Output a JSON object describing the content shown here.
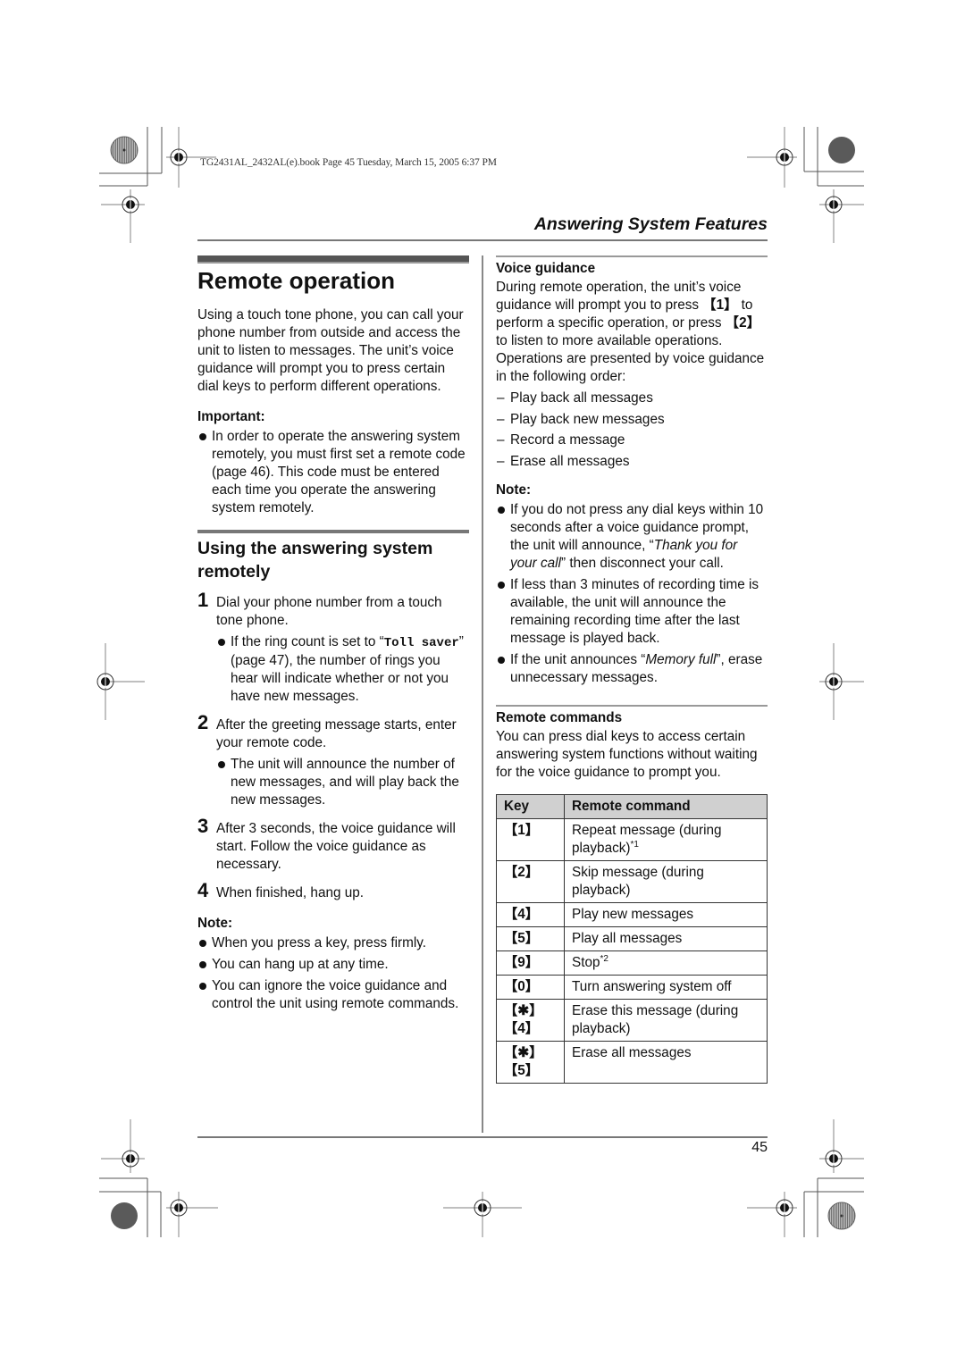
{
  "print_header": "TG2431AL_2432AL(e).book  Page 45  Tuesday, March 15, 2005  6:37 PM",
  "section_title": "Answering System Features",
  "page_number": "45",
  "left": {
    "title": "Remote operation",
    "intro": "Using a touch tone phone, you can call your phone number from outside and access the unit to listen to messages. The unit’s voice guidance will prompt you to press certain dial keys to perform different operations.",
    "important_label": "Important:",
    "important_items": [
      "In order to operate the answering system remotely, you must first set a remote code (page 46). This code must be entered each time you operate the answering system remotely."
    ],
    "subheading": "Using the answering system remotely",
    "steps": [
      {
        "num": "1",
        "text": "Dial your phone number from a touch tone phone.",
        "bullet_pre": "If the ring count is set to “",
        "bullet_mono": "Toll saver",
        "bullet_post": "” (page 47), the number of rings you hear will indicate whether or not you have new messages."
      },
      {
        "num": "2",
        "text": "After the greeting message starts, enter your remote code.",
        "bullet": "The unit will announce the number of new messages, and will play back the new messages."
      },
      {
        "num": "3",
        "text": "After 3 seconds, the voice guidance will start. Follow the voice guidance as necessary."
      },
      {
        "num": "4",
        "text": "When finished, hang up."
      }
    ],
    "note_label": "Note:",
    "notes": [
      "When you press a key, press firmly.",
      "You can hang up at any time.",
      "You can ignore the voice guidance and control the unit using remote commands."
    ]
  },
  "right": {
    "voice_guidance_label": "Voice guidance",
    "vg_text_1": "During remote operation, the unit’s voice guidance will prompt you to press ",
    "vg_key_1": "【1】",
    "vg_text_2": " to perform a specific operation, or press ",
    "vg_key_2": "【2】",
    "vg_text_3": " to listen to more available operations. Operations are presented by voice guidance in the following order:",
    "dash_mark": "–",
    "order_items": [
      "Play back all messages",
      "Play back new messages",
      "Record a message",
      "Erase all messages"
    ],
    "note_label": "Note:",
    "note1_pre": "If you do not press any dial keys within 10 seconds after a voice guidance prompt, the unit will announce, “",
    "note1_italic": "Thank you for your call",
    "note1_post": "” then disconnect your call.",
    "note2": "If less than 3 minutes of recording time is available, the unit will announce the remaining recording time after the last message is played back.",
    "note3_pre": "If the unit announces “",
    "note3_italic": "Memory full",
    "note3_post": "”, erase unnecessary messages.",
    "remote_commands_label": "Remote commands",
    "remote_commands_text": "You can press dial keys to access certain answering system functions without waiting for the voice guidance to prompt you.",
    "table": {
      "headers": [
        "Key",
        "Remote command"
      ],
      "rows": [
        {
          "key": "【1】",
          "command": "Repeat message (during playback)",
          "sup": "*1"
        },
        {
          "key": "【2】",
          "command": "Skip message (during playback)",
          "sup": ""
        },
        {
          "key": "【4】",
          "command": "Play new messages",
          "sup": ""
        },
        {
          "key": "【5】",
          "command": "Play all messages",
          "sup": ""
        },
        {
          "key": "【9】",
          "command": "Stop",
          "sup": "*2"
        },
        {
          "key": "【0】",
          "command": "Turn answering system off",
          "sup": ""
        },
        {
          "key": "【✱】【4】",
          "command": "Erase this message (during playback)",
          "sup": ""
        },
        {
          "key": "【✱】【5】",
          "command": "Erase all messages",
          "sup": ""
        }
      ]
    }
  }
}
